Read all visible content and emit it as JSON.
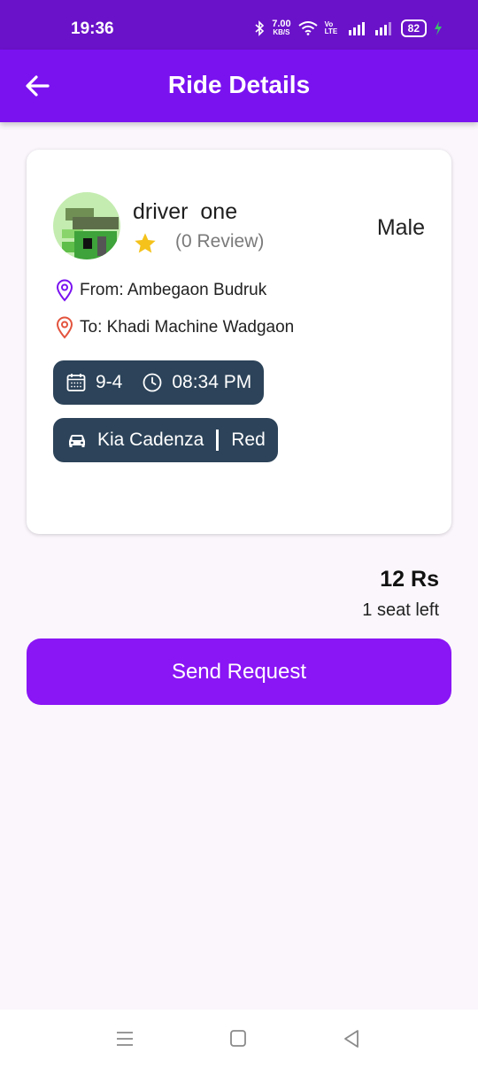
{
  "status_bar": {
    "time": "19:36",
    "net_speed": "7.00",
    "net_unit": "KB/S",
    "volte": "Vo LTE",
    "battery": "82"
  },
  "app_bar": {
    "title": "Ride Details",
    "back_icon": "arrow-left-icon"
  },
  "driver": {
    "name": "driver  one",
    "reviews": "(0 Review)",
    "gender": "Male",
    "rating_icon": "star-icon",
    "star_color": "#f4c21b"
  },
  "route": {
    "from": "From: Ambegaon Budruk",
    "to": "To: Khadi Machine Wadgaon",
    "from_icon_color": "#7a12f0",
    "to_icon_color": "#e3533d"
  },
  "schedule": {
    "date": "9-4",
    "time": "08:34 PM"
  },
  "vehicle": {
    "model": "Kia Cadenza",
    "color": "Red"
  },
  "fare": {
    "price": "12 Rs",
    "seats": "1 seat left"
  },
  "actions": {
    "send_request": "Send Request"
  },
  "colors": {
    "primary": "#7a12f0",
    "status_bar": "#6a12c9",
    "pill_bg": "#2c4359",
    "button": "#8a15f5"
  }
}
